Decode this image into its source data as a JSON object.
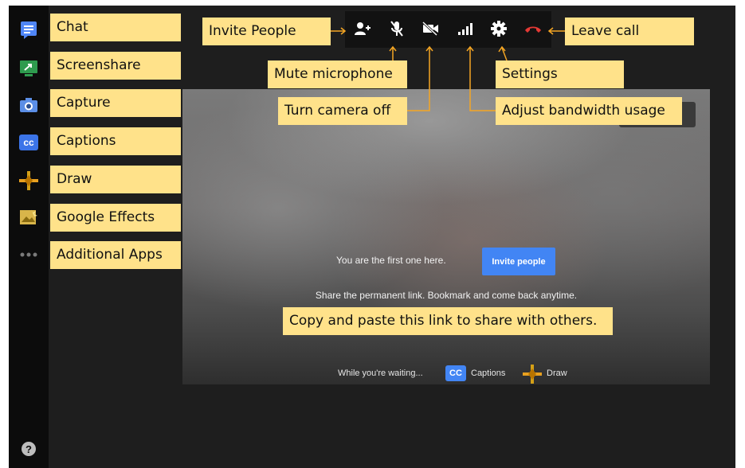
{
  "sidebar": {
    "icons": [
      "chat-icon",
      "screenshare-icon",
      "capture-icon",
      "captions-icon",
      "draw-icon",
      "google-effects-icon",
      "more-icon",
      "help-icon"
    ],
    "captions_badge": "cc",
    "help_glyph": "?"
  },
  "toolbar": {
    "buttons": [
      "invite-people-icon",
      "mute-microphone-icon",
      "camera-off-icon",
      "bandwidth-icon",
      "settings-icon",
      "leave-call-icon"
    ],
    "leave_color": "#e53935"
  },
  "callouts": {
    "chat": "Chat",
    "screenshare": "Screenshare",
    "capture": "Capture",
    "captions": "Captions",
    "draw": "Draw",
    "google_effects": "Google Effects",
    "additional_apps": "Additional Apps",
    "invite_people": "Invite People",
    "leave_call": "Leave call",
    "mute_microphone": "Mute microphone",
    "settings": "Settings",
    "turn_camera_off": "Turn camera off",
    "adjust_bandwidth": "Adjust bandwidth usage",
    "copy_link": "Copy and paste this link to share with others."
  },
  "main": {
    "first_one_text": "You are the first one here.",
    "invite_button": "Invite people",
    "share_text": "Share the permanent link. Bookmark and come back anytime.",
    "waiting_text": "While you're waiting...",
    "cc_badge": "CC",
    "captions_label": "Captions",
    "draw_label": "Draw"
  },
  "colors": {
    "callout": "#ffe28a",
    "accent_blue": "#4285f4",
    "connector": "#f5a623"
  }
}
